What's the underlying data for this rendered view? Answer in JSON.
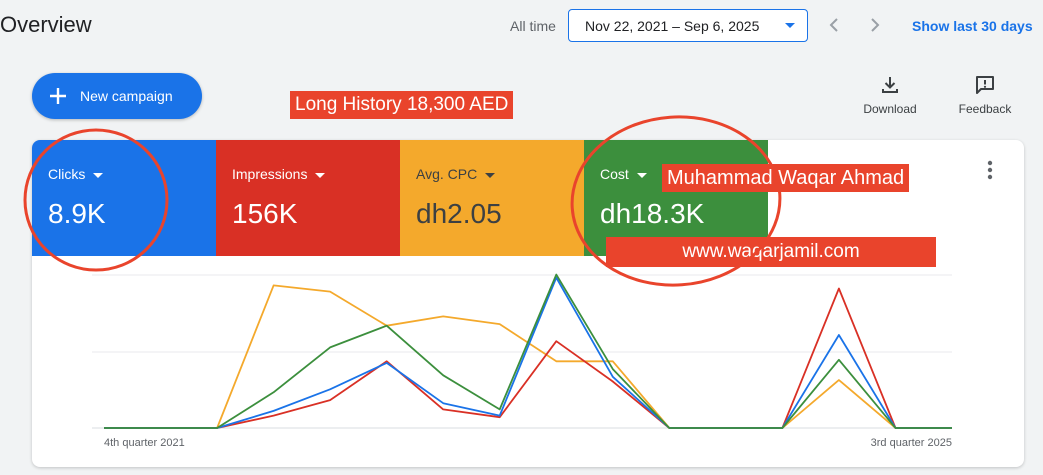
{
  "header": {
    "title": "Overview",
    "range_prefix": "All time",
    "date_range": "Nov 22, 2021 – Sep 6, 2025",
    "show_last": "Show last 30 days"
  },
  "actions": {
    "new_campaign": "New campaign",
    "download": "Download",
    "feedback": "Feedback"
  },
  "annotations": {
    "long_history": "Long History 18,300 AED",
    "author": "Muhammad Waqar Ahmad",
    "website": "www.waqarjamil.com",
    "circle_color": "#e9442c"
  },
  "metrics": [
    {
      "label": "Clicks",
      "value": "8.9K",
      "color": "#1a73e8"
    },
    {
      "label": "Impressions",
      "value": "156K",
      "color": "#d93025"
    },
    {
      "label": "Avg. CPC",
      "value": "dh2.05",
      "color": "#f4a92c"
    },
    {
      "label": "Cost",
      "value": "dh18.3K",
      "color": "#3c8f3d"
    }
  ],
  "chart_data": {
    "type": "line",
    "x_start_label": "4th quarter 2021",
    "x_end_label": "3rd quarter 2025",
    "grid": true,
    "ylim": [
      0,
      1
    ],
    "x": [
      0,
      1,
      2,
      3,
      4,
      5,
      6,
      7,
      8,
      9,
      10,
      11,
      12,
      13,
      14,
      15
    ],
    "series": [
      {
        "color": "#1a73e8",
        "values": [
          0,
          0,
          0,
          0.11,
          0.25,
          0.42,
          0.16,
          0.08,
          0.97,
          0.33,
          0,
          0,
          0,
          0.6,
          0,
          0
        ]
      },
      {
        "color": "#d93025",
        "values": [
          0,
          0,
          0,
          0.08,
          0.18,
          0.43,
          0.12,
          0.07,
          0.56,
          0.3,
          0,
          0,
          0,
          0.9,
          0,
          0
        ]
      },
      {
        "color": "#f4a92c",
        "values": [
          0,
          0,
          0,
          0.92,
          0.88,
          0.66,
          0.72,
          0.67,
          0.43,
          0.43,
          0,
          0,
          0,
          0.31,
          0,
          0
        ]
      },
      {
        "color": "#3c8f3d",
        "values": [
          0,
          0,
          0,
          0.23,
          0.52,
          0.66,
          0.34,
          0.12,
          0.99,
          0.38,
          0,
          0,
          0,
          0.44,
          0,
          0
        ]
      }
    ]
  }
}
